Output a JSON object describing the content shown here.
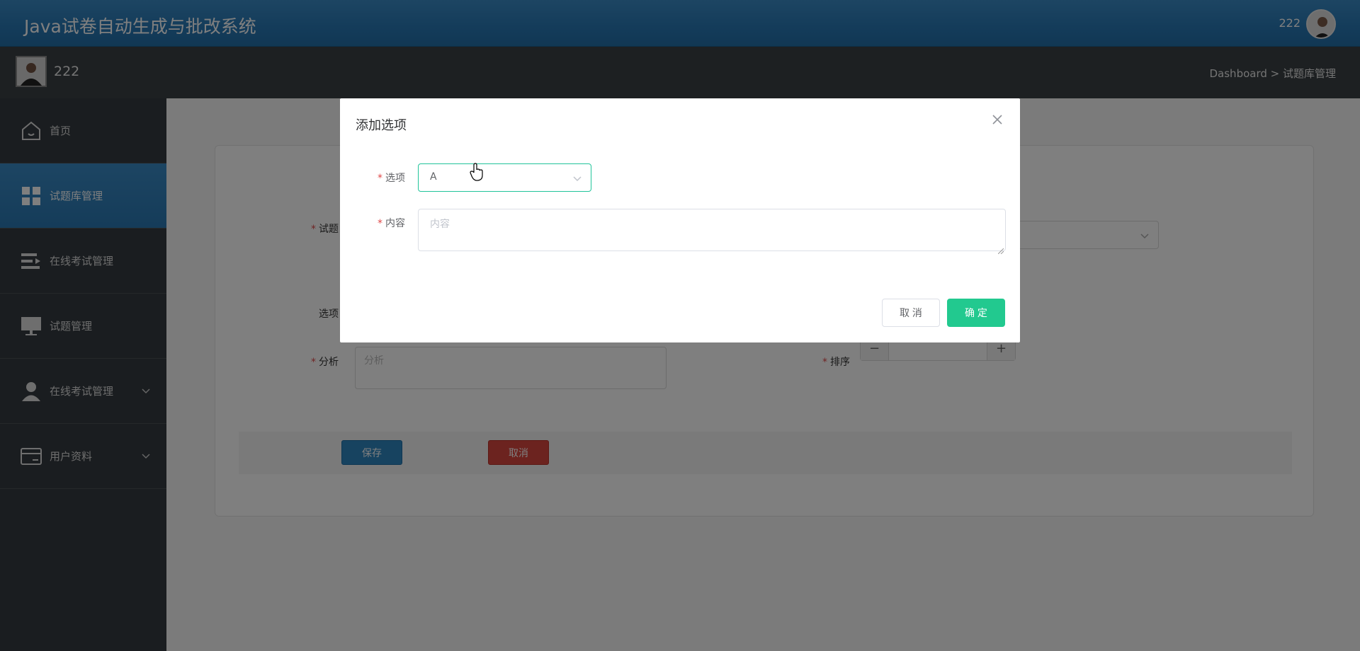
{
  "header": {
    "app_title": "Java试卷自动生成与批改系统",
    "username": "222"
  },
  "subbar": {
    "username": "222",
    "breadcrumb": "Dashboard > 试题库管理"
  },
  "sidebar": {
    "items": [
      {
        "label": "首页",
        "icon": "home-icon"
      },
      {
        "label": "试题库管理",
        "icon": "grid-icon",
        "active": true
      },
      {
        "label": "在线考试管理",
        "icon": "list-icon"
      },
      {
        "label": "试题管理",
        "icon": "monitor-icon"
      },
      {
        "label": "在线考试管理",
        "icon": "user-icon",
        "expandable": true
      },
      {
        "label": "用户资料",
        "icon": "card-icon",
        "expandable": true
      }
    ]
  },
  "form": {
    "label_question": "试题",
    "label_option": "选项",
    "label_analysis": "分析",
    "analysis_placeholder": "分析",
    "label_sort": "排序",
    "stepper_minus": "−",
    "stepper_plus": "+",
    "save_label": "保存",
    "cancel_label": "取消"
  },
  "dialog": {
    "title": "添加选项",
    "option_label": "选项",
    "option_value": "A",
    "content_label": "内容",
    "content_placeholder": "内容",
    "cancel_label": "取 消",
    "ok_label": "确 定"
  },
  "colors": {
    "primary": "#2f86c0",
    "danger": "#d9473f",
    "success": "#22c98f",
    "sidebar": "#353b40"
  }
}
